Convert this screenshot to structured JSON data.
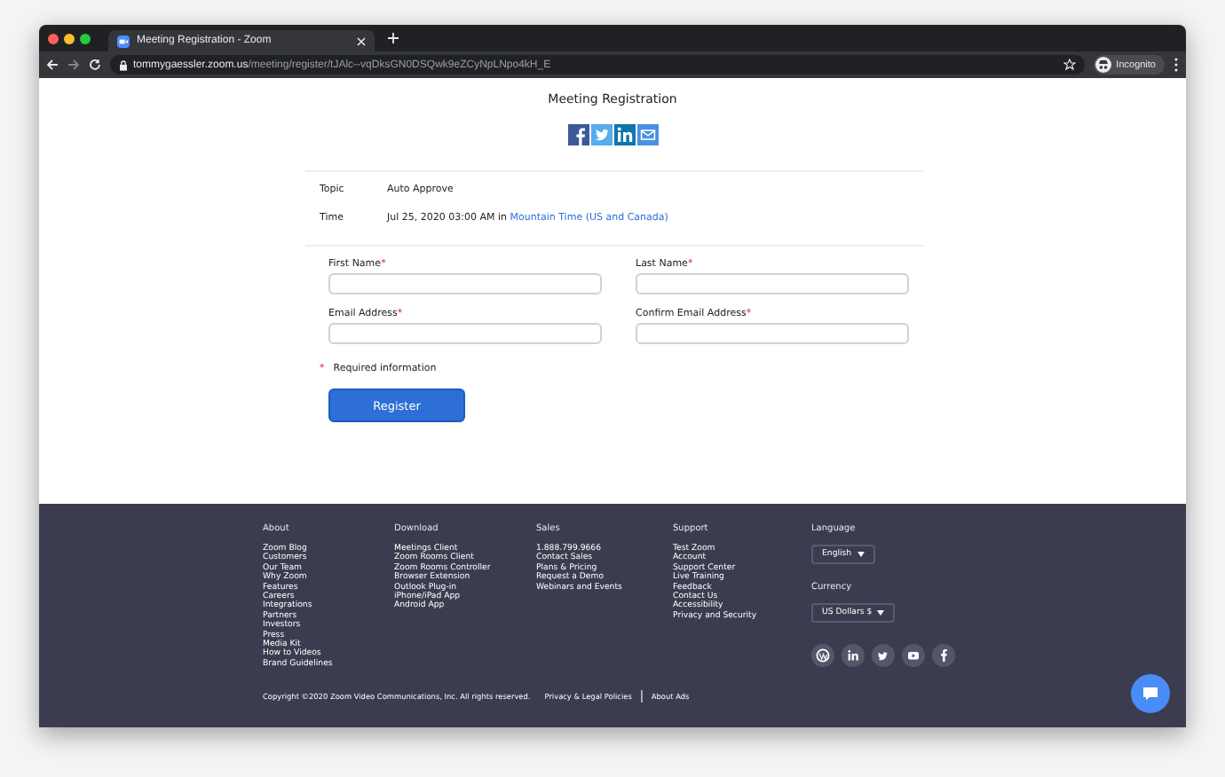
{
  "browser": {
    "tab_title": "Meeting Registration - Zoom",
    "url_host": "tommygaessler.zoom.us",
    "url_path": "/meeting/register/tJAlc--vqDksGN0DSQwk9eZCyNpLNpo4kH_E",
    "profile_label": "Incognito"
  },
  "page": {
    "title": "Meeting Registration",
    "details": [
      {
        "label": "Topic",
        "value": "Auto Approve"
      },
      {
        "label": "Time",
        "value": "Jul 25, 2020 03:00 AM in ",
        "link": "Mountain Time (US and Canada)"
      }
    ],
    "fields": [
      {
        "label": "First Name",
        "mark": "*"
      },
      {
        "label": "Last Name",
        "mark": "*"
      },
      {
        "label": "Email Address",
        "mark": "*"
      },
      {
        "label": "Confirm Email Address",
        "mark": "*"
      }
    ],
    "required_note": {
      "mark": "*",
      "text": "Required information"
    },
    "register_button": "Register"
  },
  "footer": {
    "columns": [
      {
        "heading": "About",
        "links": [
          "Zoom Blog",
          "Customers",
          "Our Team",
          "Why Zoom",
          "Features",
          "Careers",
          "Integrations",
          "Partners",
          "Investors",
          "Press",
          "Media Kit",
          "How to Videos",
          "Brand Guidelines"
        ]
      },
      {
        "heading": "Download",
        "links": [
          "Meetings Client",
          "Zoom Rooms Client",
          "Zoom Rooms Controller",
          "Browser Extension",
          "Outlook Plug-in",
          "iPhone/iPad App",
          "Android App"
        ]
      },
      {
        "heading": "Sales",
        "links": [
          "1.888.799.9666",
          "Contact Sales",
          "Plans & Pricing",
          "Request a Demo",
          "Webinars and Events"
        ]
      },
      {
        "heading": "Support",
        "links": [
          "Test Zoom",
          "Account",
          "Support Center",
          "Live Training",
          "Feedback",
          "Contact Us",
          "Accessibility",
          "Privacy and Security"
        ]
      }
    ],
    "language": {
      "label": "Language",
      "value": "English"
    },
    "currency": {
      "label": "Currency",
      "value": "US Dollars $"
    },
    "copyright": "Copyright ©2020 Zoom Video Communications, Inc. All rights reserved.",
    "legal_links": [
      "Privacy & Legal Policies",
      "About Ads"
    ]
  }
}
